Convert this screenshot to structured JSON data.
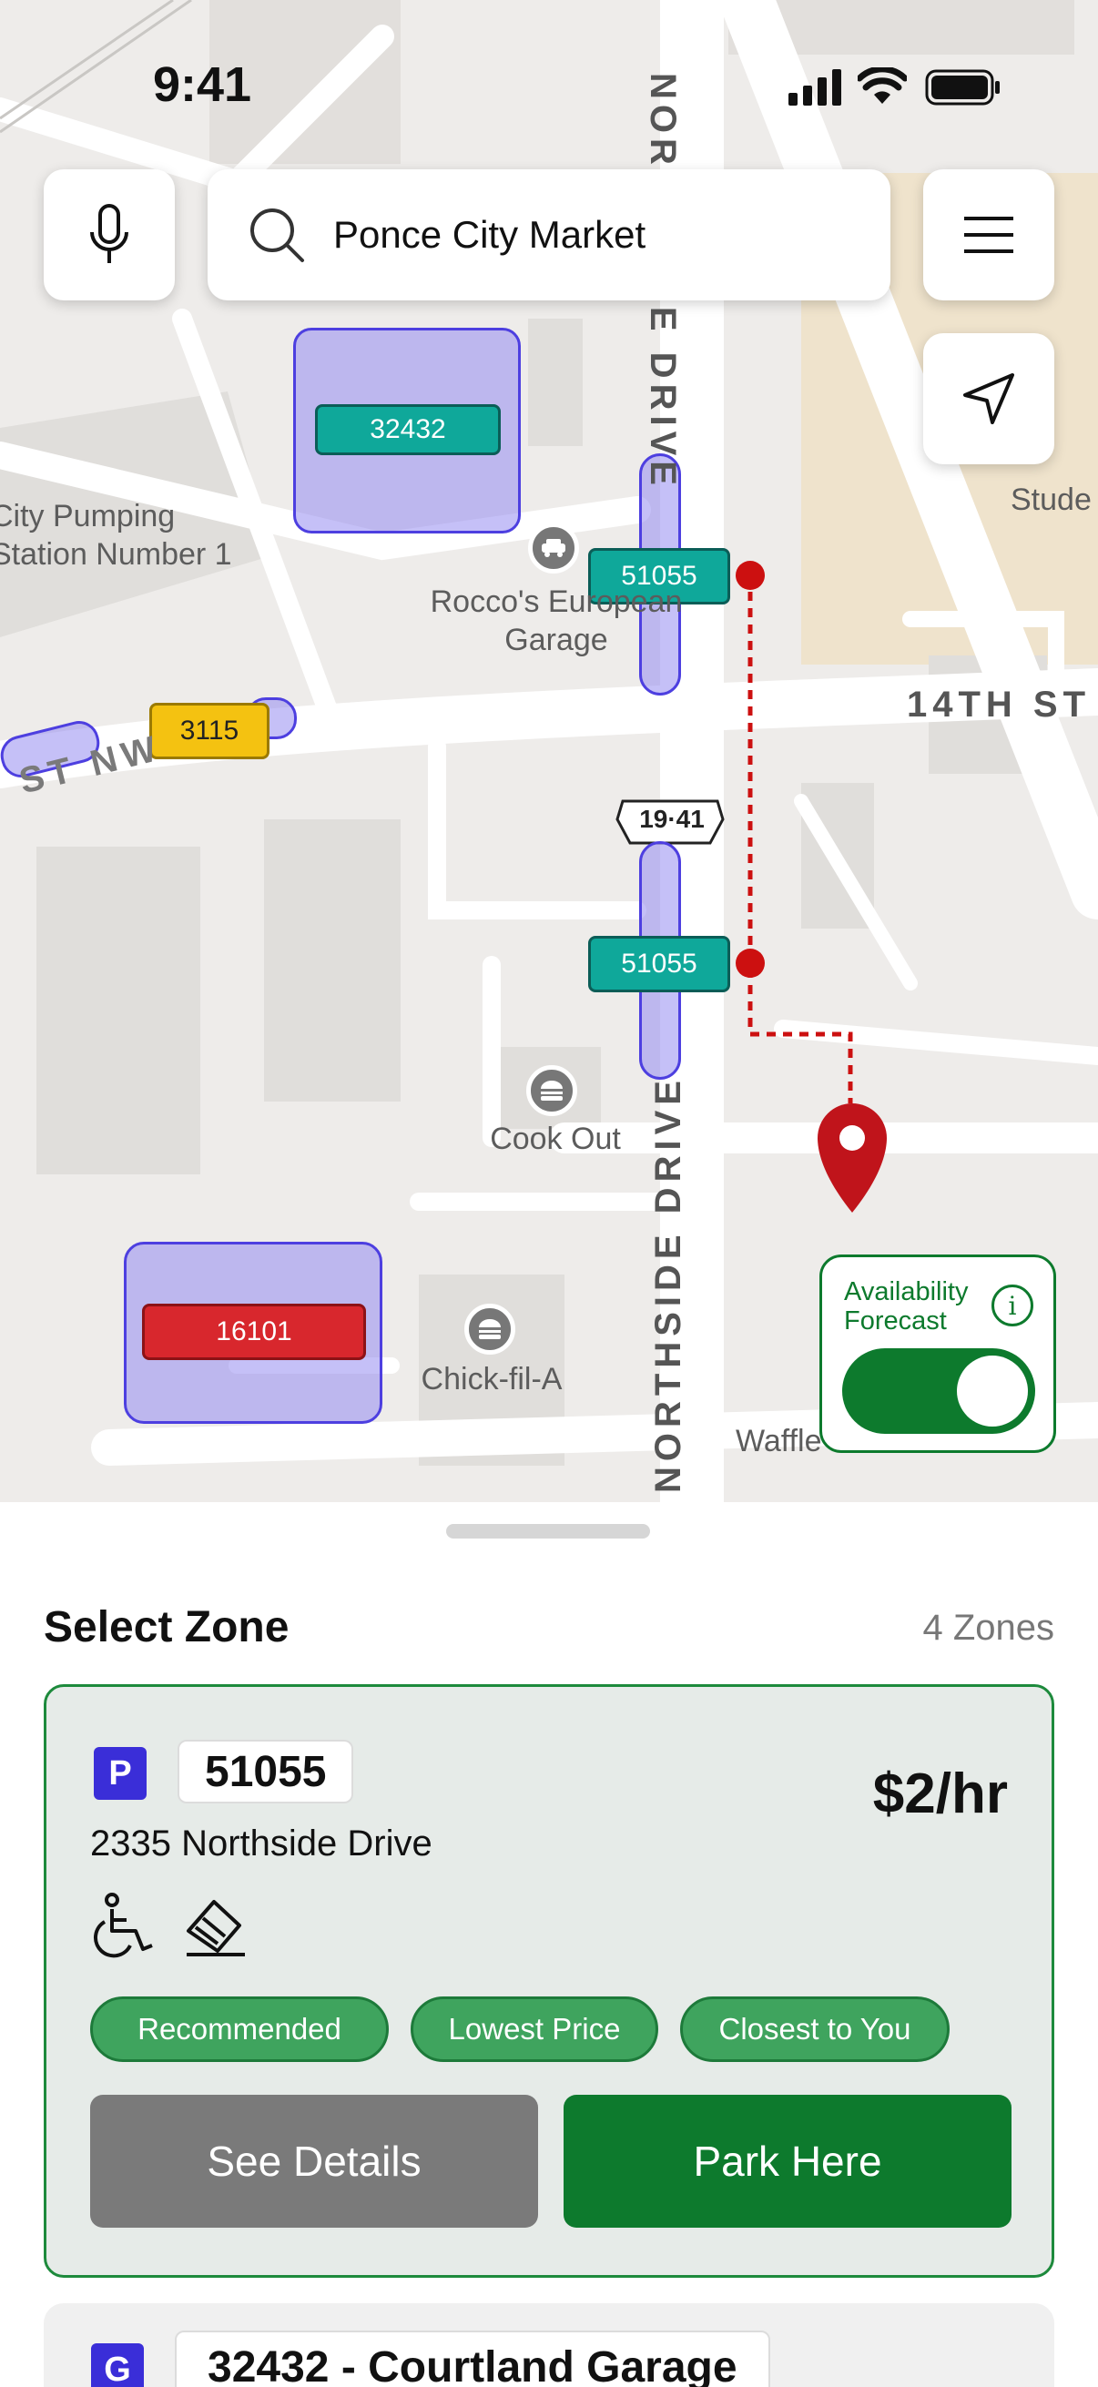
{
  "status_bar": {
    "time": "9:41"
  },
  "search": {
    "query": "Ponce City Market"
  },
  "map": {
    "street_labels": {
      "northside_top": "NORTHSIDE DRIVE",
      "northside_bottom": "NORTHSIDE DRIVE",
      "fourteenth": "14TH ST",
      "st_nw": "ST NW"
    },
    "route_shield": "19·41",
    "places": {
      "pumping": "City Pumping\nStation Number 1",
      "roccos": "Rocco's European\nGarage",
      "cook_out": "Cook Out",
      "chick": "Chick-fil-A",
      "waffle": "Waffle",
      "stude": "Stude"
    },
    "zones": [
      {
        "id": "32432",
        "color": "teal"
      },
      {
        "id": "51055",
        "color": "teal"
      },
      {
        "id": "3115",
        "color": "yellow"
      },
      {
        "id": "51055",
        "color": "teal"
      },
      {
        "id": "16101",
        "color": "red"
      }
    ],
    "forecast": {
      "label": "Availability Forecast",
      "enabled": true
    }
  },
  "sheet": {
    "title": "Select Zone",
    "count": "4 Zones",
    "cards": [
      {
        "badge": "P",
        "zone_id": "51055",
        "price": "$2/hr",
        "address": "2335 Northside Drive",
        "features": [
          "wheelchair-icon",
          "ev-charging-icon"
        ],
        "tags": [
          "Recommended",
          "Lowest Price",
          "Closest to You"
        ],
        "buttons": {
          "details": "See Details",
          "park": "Park Here"
        }
      },
      {
        "badge": "G",
        "zone_id": "32432 - Courtland Garage"
      }
    ]
  },
  "colors": {
    "zone_fill": "#968cf0",
    "teal": "#0fa89a",
    "yellow": "#f4c211",
    "red": "#d8272d",
    "accent_green": "#0d7a2d",
    "route_red": "#cc1010"
  }
}
